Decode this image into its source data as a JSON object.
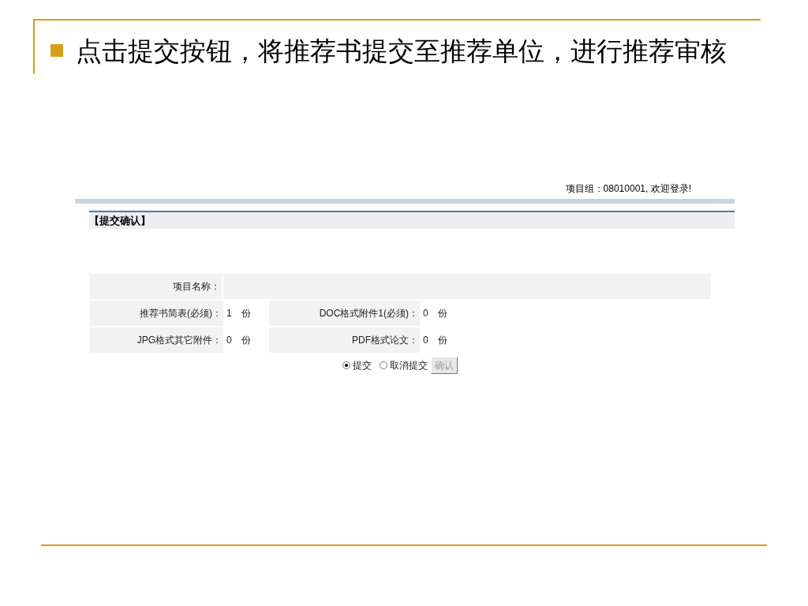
{
  "slide": {
    "title": "点击提交按钮，将推荐书提交至推荐单位，进行推荐审核"
  },
  "page": {
    "welcome": "项目组：08010001, 欢迎登录!",
    "section_title": "【提交确认】",
    "name_row": {
      "label": "项目名称："
    },
    "rows": [
      [
        {
          "label": "推荐书简表(必须)：",
          "count": "1",
          "unit": "份"
        },
        {
          "label": "DOC格式附件1(必须)：",
          "count": "0",
          "unit": "份"
        }
      ],
      [
        {
          "label": "JPG格式其它附件：",
          "count": "0",
          "unit": "份"
        },
        {
          "label": "PDF格式论文：",
          "count": "0",
          "unit": "份"
        }
      ]
    ],
    "options": [
      {
        "label": "提交",
        "selected": true
      },
      {
        "label": "取消提交",
        "selected": false
      }
    ],
    "confirm_button": {
      "label": "确认",
      "disabled": true
    }
  }
}
